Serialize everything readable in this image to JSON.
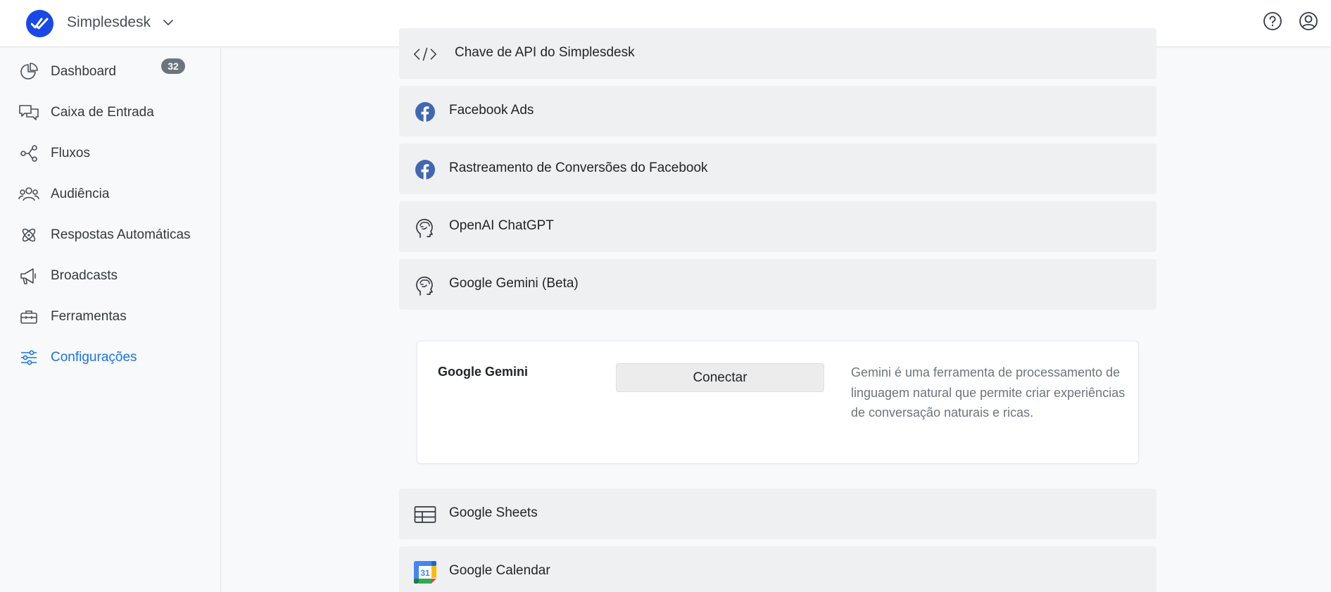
{
  "header": {
    "workspace_name": "Simplesdesk",
    "logo_icon": "double-check-logo",
    "help_icon": "question-circle-icon",
    "account_icon": "user-circle-icon"
  },
  "sidebar": {
    "items": [
      {
        "label": "Dashboard",
        "icon": "pie-chart-icon"
      },
      {
        "label": "Caixa de Entrada",
        "icon": "chat-bubbles-icon",
        "badge": "32"
      },
      {
        "label": "Fluxos",
        "icon": "share-nodes-icon"
      },
      {
        "label": "Audiência",
        "icon": "users-icon"
      },
      {
        "label": "Respostas Automáticas",
        "icon": "atom-icon"
      },
      {
        "label": "Broadcasts",
        "icon": "megaphone-icon"
      },
      {
        "label": "Ferramentas",
        "icon": "toolbox-icon"
      },
      {
        "label": "Configurações",
        "icon": "sliders-icon",
        "active": true
      }
    ]
  },
  "integrations": {
    "items": [
      {
        "label": "Chave de API do Simplesdesk",
        "icon": "code-icon"
      },
      {
        "label": "Facebook Ads",
        "icon": "facebook-icon"
      },
      {
        "label": "Rastreamento de Conversões do Facebook",
        "icon": "facebook-icon"
      },
      {
        "label": "OpenAI ChatGPT",
        "icon": "ai-head-icon"
      },
      {
        "label": "Google Gemini (Beta)",
        "icon": "ai-head-icon"
      },
      {
        "label": "Google Sheets",
        "icon": "table-icon"
      },
      {
        "label": "Google Calendar",
        "icon": "google-calendar-icon",
        "calendar_day": "31"
      }
    ],
    "expanded": {
      "title": "Google Gemini",
      "button_label": "Conectar",
      "description": "Gemini é uma ferramenta de processamento de linguagem natural que permite criar experiências de conversação naturais e ricas."
    }
  },
  "colors": {
    "accent": "#1a73e8",
    "logo": "#1a47e8",
    "facebook": "#4267b2",
    "badge": "#6c757d"
  }
}
